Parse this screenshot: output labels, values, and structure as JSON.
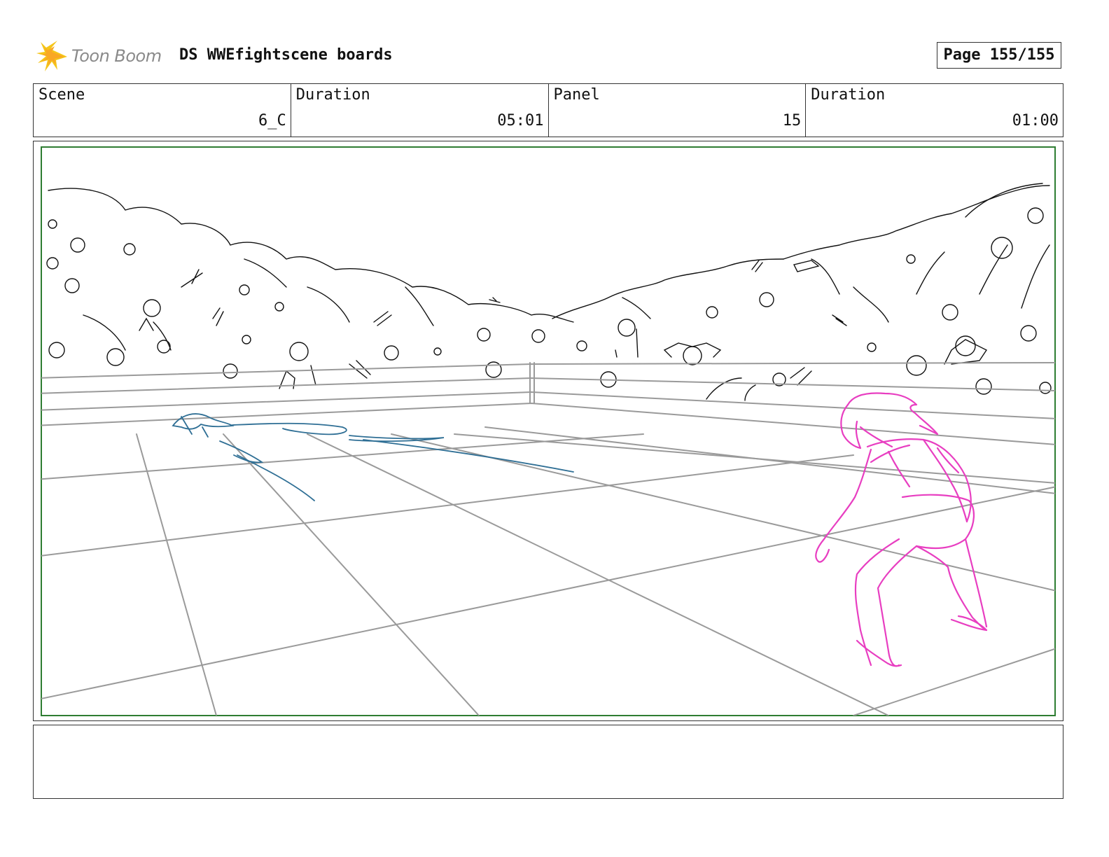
{
  "header": {
    "logo_text": "Toon Boom",
    "document_title": "DS WWEfightscene boards",
    "page_label": "Page 155/155"
  },
  "info": [
    {
      "label": "Scene",
      "value": "6_C"
    },
    {
      "label": "Duration",
      "value": "05:01"
    },
    {
      "label": "Panel",
      "value": "15"
    },
    {
      "label": "Duration",
      "value": "01:00"
    }
  ],
  "notes": {
    "text": ""
  },
  "colors": {
    "frame_border": "#2e7d32",
    "crowd_ink": "#111111",
    "ring_ink": "#9a9a9a",
    "fallen_character": "#2f6f95",
    "standing_character": "#e83ec1",
    "logo_accent": "#f5c518"
  }
}
